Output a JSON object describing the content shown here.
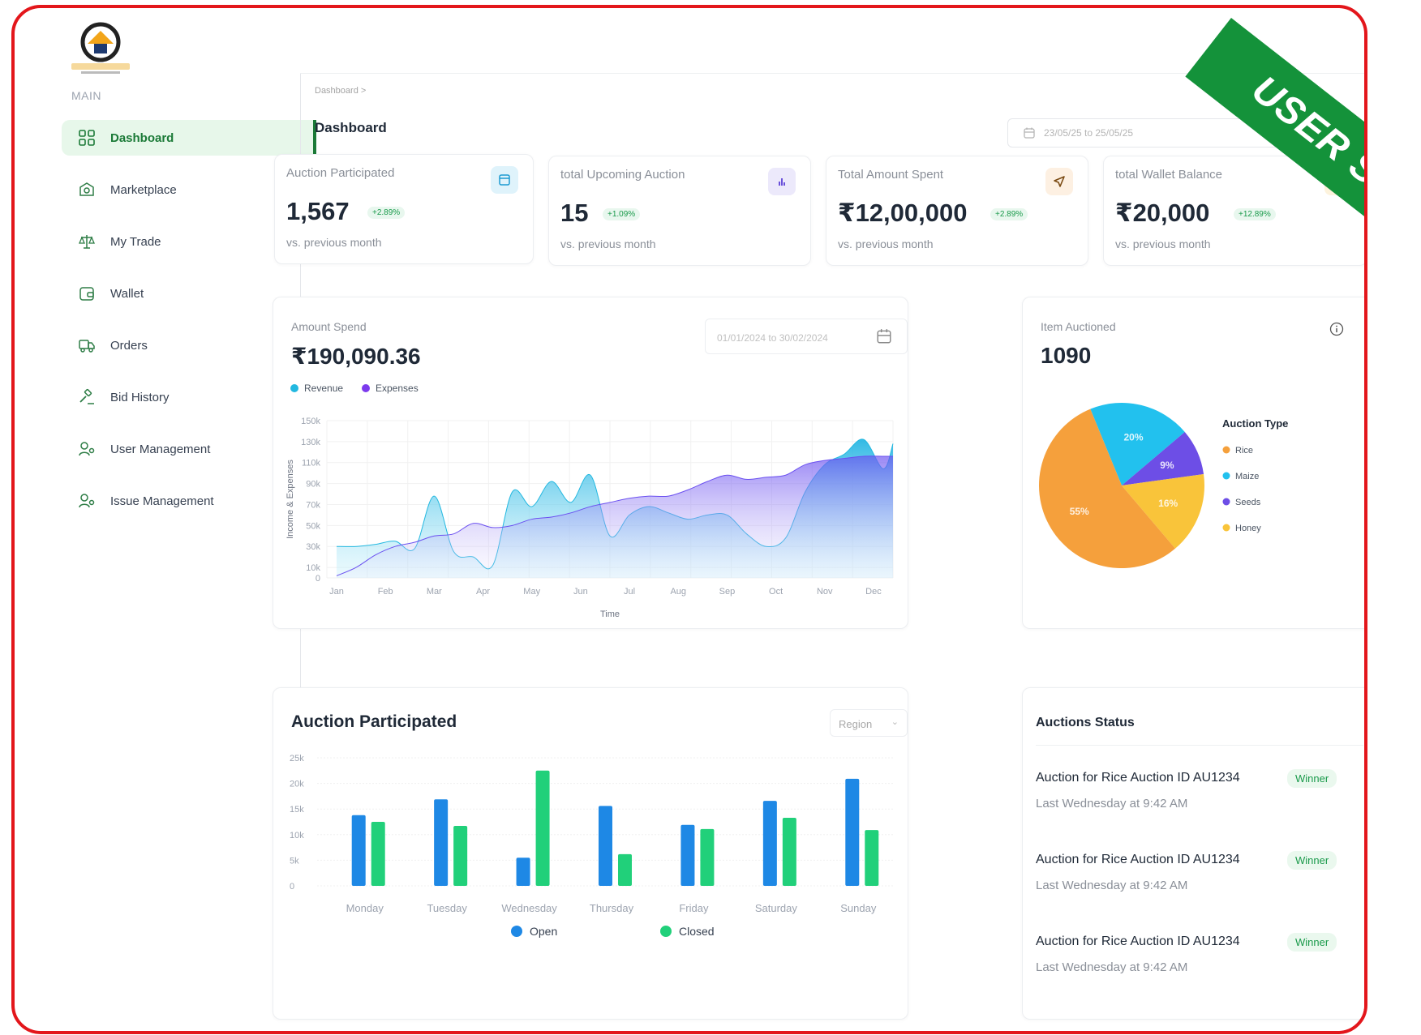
{
  "ribbon": "USER SIDE",
  "sidebar": {
    "section": "MAIN",
    "items": [
      {
        "label": "Dashboard",
        "icon": "grid-icon",
        "active": true
      },
      {
        "label": "Marketplace",
        "icon": "shop-icon"
      },
      {
        "label": "My Trade",
        "icon": "scale-icon"
      },
      {
        "label": "Wallet",
        "icon": "wallet-icon"
      },
      {
        "label": "Orders",
        "icon": "truck-icon"
      },
      {
        "label": "Bid History",
        "icon": "gavel-icon"
      },
      {
        "label": "User Management",
        "icon": "user-icon"
      },
      {
        "label": "Issue Management",
        "icon": "user-icon"
      }
    ]
  },
  "header": {
    "breadcrumb": "Dashboard  >",
    "title": "Dashboard",
    "date_range": "23/05/25 to 25/05/25"
  },
  "stats": [
    {
      "label": "Auction Participated",
      "value": "1,567",
      "change": "+2.89%",
      "sub": "vs. previous month",
      "icon": "calendar-icon",
      "color": "#dff3fb"
    },
    {
      "label": "total Upcoming Auction",
      "value": "15",
      "change": "+1.09%",
      "sub": "vs. previous month",
      "icon": "bar-chart-icon",
      "color": "#ece9fb"
    },
    {
      "label": "Total Amount Spent",
      "value": "₹12,00,000",
      "change": "+2.89%",
      "sub": "vs. previous month",
      "icon": "send-icon",
      "color": "#fdf0e2"
    },
    {
      "label": "total Wallet Balance",
      "value": "₹20,000",
      "change": "+12.89%",
      "sub": "vs. previous month",
      "icon": "users-icon",
      "color": "#fdf3dd"
    }
  ],
  "amount_spend": {
    "title": "Amount Spend",
    "value": "₹190,090.36",
    "date_range": "01/01/2024 to 30/02/2024"
  },
  "item_auctioned": {
    "title": "Item Auctioned",
    "value": "1090"
  },
  "auction_participated": {
    "title": "Auction Participated",
    "region": "Region"
  },
  "auctions_status": {
    "title": "Auctions Status",
    "items": [
      {
        "title": "Auction for Rice Auction ID AU1234",
        "badge": "Winner",
        "time": "Last Wednesday at 9:42 AM"
      },
      {
        "title": "Auction for Rice Auction ID AU1234",
        "badge": "Winner",
        "time": "Last Wednesday at 9:42 AM"
      },
      {
        "title": "Auction for Rice Auction ID AU1234",
        "badge": "Winner",
        "time": "Last Wednesday at 9:42 AM"
      }
    ]
  },
  "chart_data": [
    {
      "type": "area",
      "title": "",
      "xlabel": "Time",
      "ylabel": "Income & Expenses",
      "categories": [
        "Jan",
        "Feb",
        "Mar",
        "Apr",
        "May",
        "Jun",
        "Jul",
        "Aug",
        "Sep",
        "Oct",
        "Nov",
        "Dec"
      ],
      "yticks": [
        "0",
        "10k",
        "30k",
        "50k",
        "70k",
        "90k",
        "110k",
        "130k",
        "150k"
      ],
      "ylim": [
        0,
        150000
      ],
      "series": [
        {
          "name": "Revenue",
          "color": "#22b8e0",
          "x": [
            0,
            0.4,
            0.8,
            1.2,
            1.6,
            2.0,
            2.4,
            2.8,
            3.2,
            3.6,
            4.0,
            4.4,
            4.8,
            5.2,
            5.6,
            6.0,
            6.4,
            6.8,
            7.2,
            7.6,
            8.0,
            8.4,
            8.8,
            9.2,
            9.6,
            10.0,
            10.4,
            10.8,
            11.2,
            11.4
          ],
          "values": [
            30000,
            30000,
            32000,
            35000,
            28000,
            78000,
            25000,
            20000,
            12000,
            82000,
            68000,
            92000,
            72000,
            98000,
            40000,
            60000,
            68000,
            62000,
            56000,
            60000,
            60000,
            42000,
            30000,
            38000,
            82000,
            108000,
            118000,
            132000,
            104000,
            128000
          ]
        },
        {
          "name": "Expenses",
          "color": "#7c3aed",
          "x": [
            0,
            0.4,
            0.8,
            1.2,
            1.6,
            2.0,
            2.4,
            2.8,
            3.2,
            3.6,
            4.0,
            4.4,
            4.8,
            5.2,
            5.6,
            6.0,
            6.4,
            6.8,
            7.2,
            7.6,
            8.0,
            8.4,
            8.8,
            9.2,
            9.6,
            10.0,
            10.4,
            10.8,
            11.2,
            11.4
          ],
          "values": [
            2000,
            10000,
            22000,
            30000,
            34000,
            40000,
            42000,
            52000,
            48000,
            50000,
            56000,
            58000,
            62000,
            68000,
            72000,
            76000,
            78000,
            78000,
            84000,
            92000,
            98000,
            94000,
            96000,
            98000,
            108000,
            112000,
            114000,
            116000,
            116000,
            116000
          ]
        }
      ],
      "legend": "top-left"
    },
    {
      "type": "pie",
      "title": "Auction Type",
      "categories": [
        "Rice",
        "Maize",
        "Seeds",
        "Honey"
      ],
      "values": [
        55,
        20,
        9,
        16
      ],
      "labels": [
        "55%",
        "20%",
        "9%",
        "16%"
      ],
      "colors": [
        "#f5a03c",
        "#22c1ee",
        "#6d4ee6",
        "#f9c43a"
      ],
      "legend": "right"
    },
    {
      "type": "bar",
      "title": "Auction Participated",
      "categories": [
        "Monday",
        "Tuesday",
        "Wednesday",
        "Thursday",
        "Friday",
        "Saturday",
        "Sunday"
      ],
      "yticks": [
        "0",
        "5k",
        "10k",
        "15k",
        "20k",
        "25k"
      ],
      "ylim": [
        0,
        25000
      ],
      "series": [
        {
          "name": "Open",
          "color": "#1e88e5",
          "values": [
            13800,
            16900,
            5500,
            15600,
            11900,
            16600,
            20900
          ]
        },
        {
          "name": "Closed",
          "color": "#21d07a",
          "values": [
            12500,
            11700,
            22500,
            6200,
            11100,
            13300,
            10900
          ]
        }
      ],
      "legend": "bottom"
    }
  ]
}
